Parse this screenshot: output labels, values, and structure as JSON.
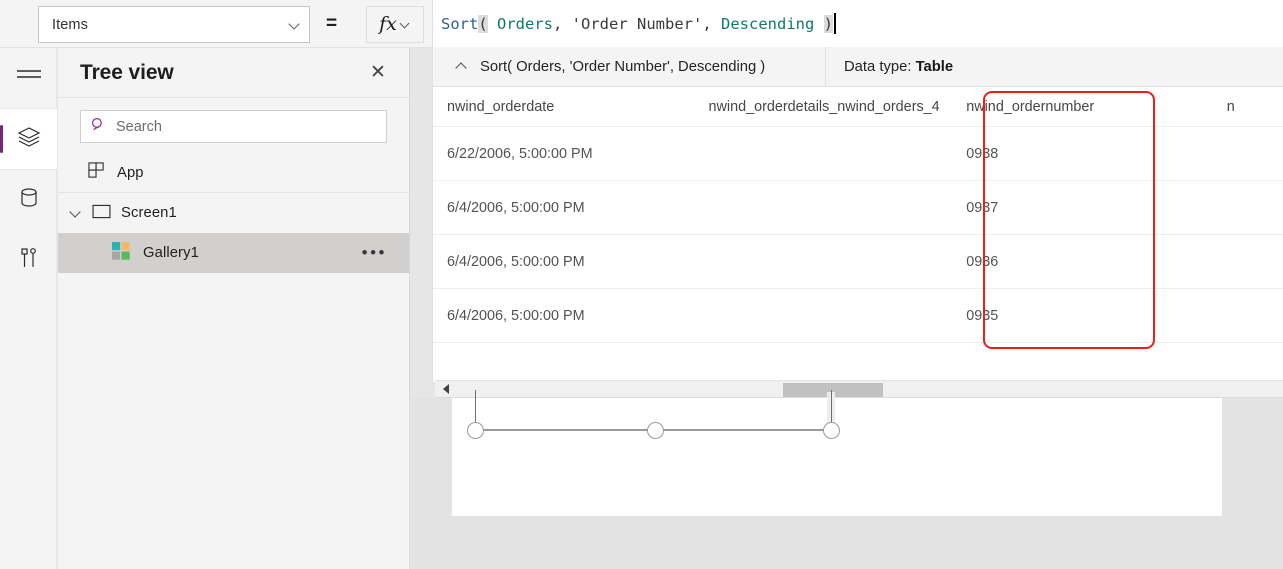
{
  "formula_bar": {
    "property_label": "Items",
    "equals": "=",
    "fx_glyph": "fx",
    "formula_tokens": [
      {
        "text": "Sort",
        "kind": "fn"
      },
      {
        "text": "(",
        "kind": "paren"
      },
      {
        "text": " Orders",
        "kind": "ident"
      },
      {
        "text": ", ",
        "kind": "plain"
      },
      {
        "text": "'Order Number'",
        "kind": "plain"
      },
      {
        "text": ", ",
        "kind": "plain"
      },
      {
        "text": "Descending",
        "kind": "ident"
      },
      {
        "text": " ",
        "kind": "plain"
      },
      {
        "text": ")",
        "kind": "paren"
      }
    ],
    "formula_plain": "Sort( Orders, 'Order Number', Descending )"
  },
  "rail": {
    "items": [
      {
        "name": "hamburger-menu-icon",
        "active": false
      },
      {
        "name": "layers-icon",
        "active": true
      },
      {
        "name": "data-cylinder-icon",
        "active": false
      },
      {
        "name": "tools-icon",
        "active": false
      }
    ]
  },
  "treeview": {
    "title": "Tree view",
    "close_label": "✕",
    "search": {
      "placeholder": "Search",
      "value": ""
    },
    "items": [
      {
        "label": "App",
        "indent": 0,
        "selected": false
      },
      {
        "label": "Screen1",
        "indent": 0,
        "selected": false,
        "expanded": true
      },
      {
        "label": "Gallery1",
        "indent": 1,
        "selected": true,
        "overflow": "•••"
      }
    ]
  },
  "result_pane": {
    "summary_formula": "Sort( Orders, 'Order Number', Descending )",
    "data_type_label": "Data type:",
    "data_type_value": "Table",
    "table": {
      "columns": [
        "nwind_orderdate",
        "nwind_orderdetails_nwind_orders_4",
        "nwind_ordernumber",
        "n"
      ],
      "rows": [
        [
          "6/22/2006, 5:00:00 PM",
          "",
          "0938",
          ""
        ],
        [
          "6/4/2006, 5:00:00 PM",
          "",
          "0937",
          ""
        ],
        [
          "6/4/2006, 5:00:00 PM",
          "",
          "0936",
          ""
        ],
        [
          "6/4/2006, 5:00:00 PM",
          "",
          "0935",
          ""
        ]
      ]
    },
    "highlight_color": "#f21b1b"
  },
  "canvas": {
    "selection_handles": 3
  },
  "colors": {
    "accent": "#742774",
    "search_icon": "#8b2f8b",
    "gallery_icon_teal": "#2bb3b3",
    "gallery_icon_orange": "#f5b765",
    "gallery_icon_gray": "#a6a6a6",
    "gallery_icon_green": "#5cb85c",
    "formula_fn": "#2f5c9e",
    "formula_ident": "#11786b"
  }
}
